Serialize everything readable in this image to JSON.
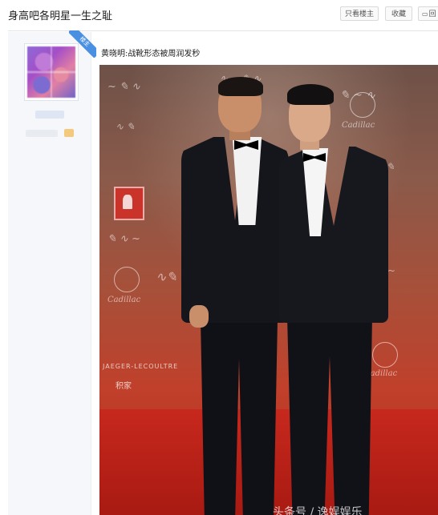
{
  "header": {
    "title": "身高吧各明星一生之耻",
    "only_owner_label": "只看楼主",
    "favorite_label": "收藏",
    "reply_label": "回"
  },
  "post": {
    "author": {
      "owner_badge": "楼主"
    },
    "text": "黄晓明:战靴形态被周润发秒",
    "image": {
      "watermark": "头条号 / 逸娱娱乐",
      "wall_text": {
        "brand_a": "Cadillac",
        "brand_b": "Cadillac",
        "brand_c": "Cadillac",
        "sponsor": "JAEGER-LECOULTRE",
        "sponsor_cn": "积家"
      }
    }
  },
  "colors": {
    "ribbon": "#4a90e2",
    "carpet": "#c0281d"
  }
}
